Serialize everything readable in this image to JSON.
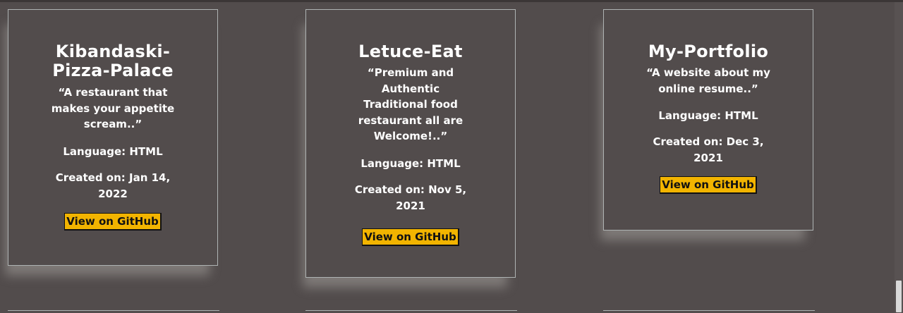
{
  "projects": [
    {
      "title": "Kibandaski-Pizza-Palace",
      "description": "“A restaurant that makes your appetite scream..”",
      "language": "Language: HTML",
      "created": "Created on: Jan 14, 2022",
      "button_label": "View on GitHub"
    },
    {
      "title": "Letuce-Eat",
      "description": "“Premium and Authentic Traditional food restaurant all are Welcome!..”",
      "language": "Language: HTML",
      "created": "Created on: Nov 5, 2021",
      "button_label": "View on GitHub"
    },
    {
      "title": "My-Portfolio",
      "description": "“A website about my online resume..”",
      "language": "Language: HTML",
      "created": "Created on: Dec 3, 2021",
      "button_label": "View on GitHub"
    }
  ],
  "colors": {
    "background": "#524c4c",
    "button": "#f2b400",
    "text": "#ffffff",
    "border": "#aeb3b3"
  }
}
